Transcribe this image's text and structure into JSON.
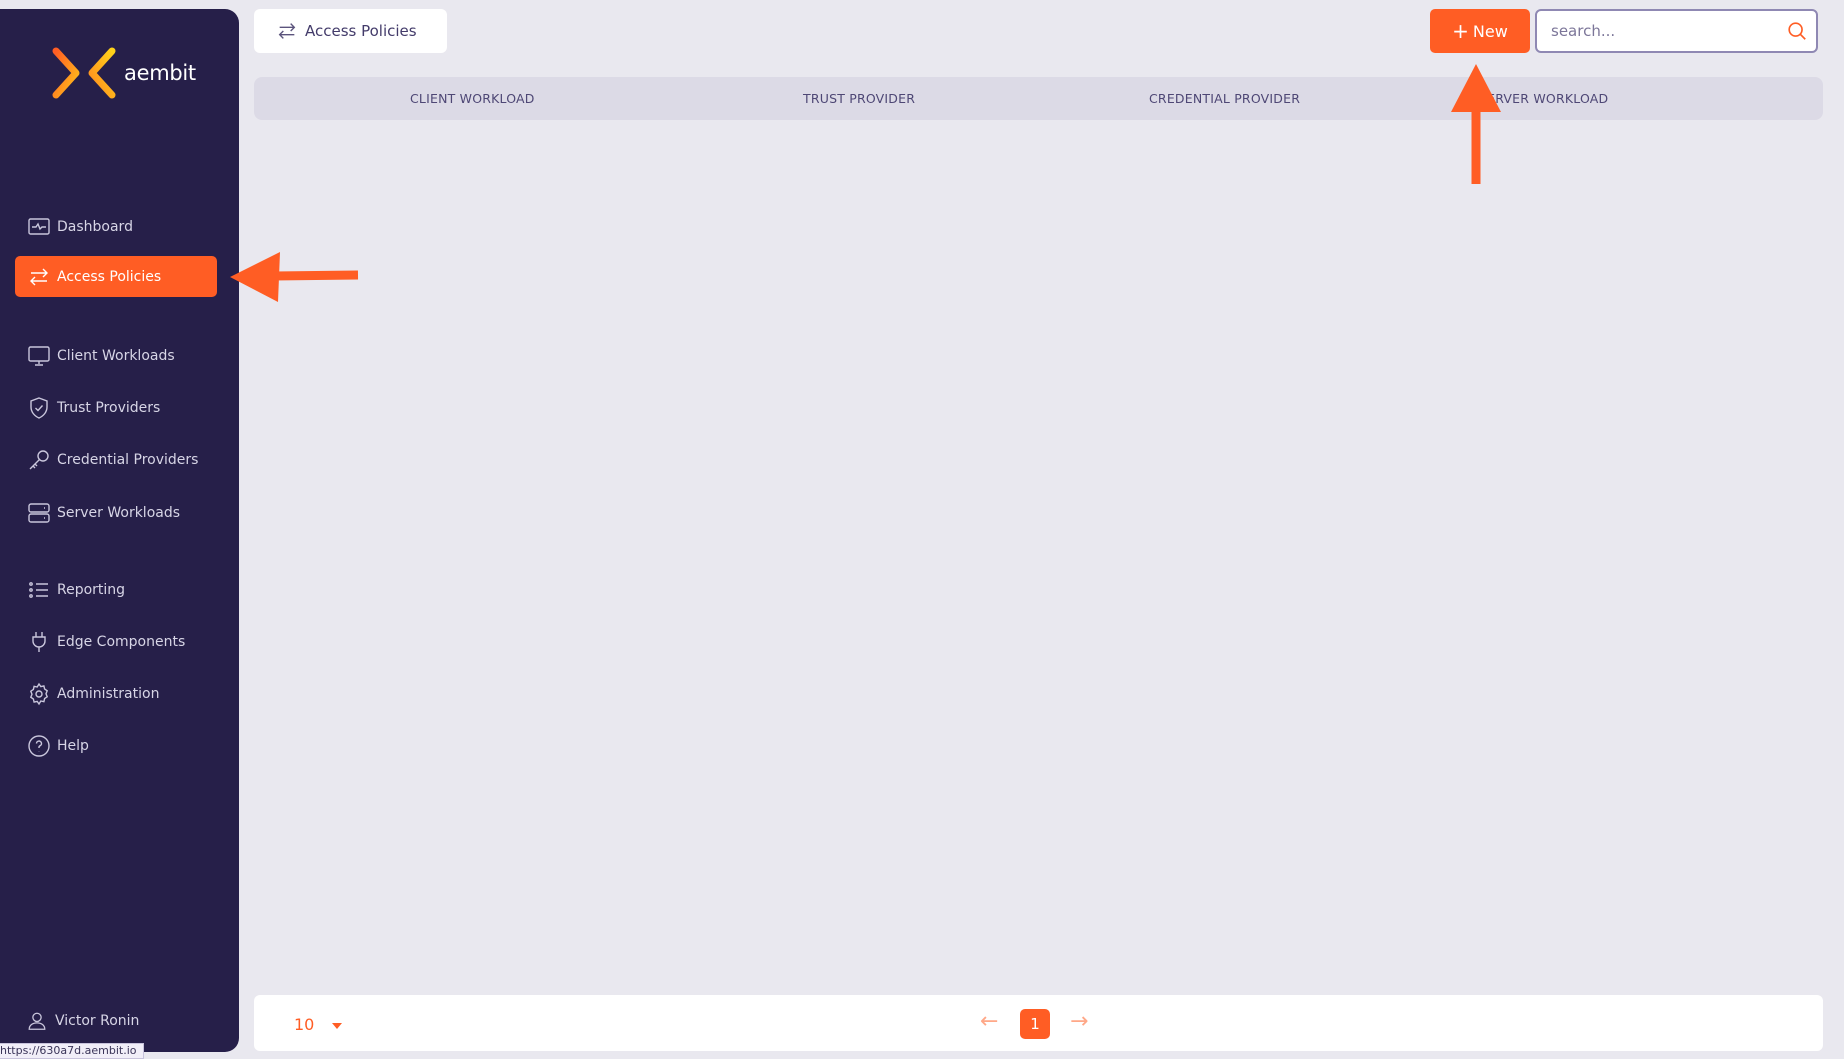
{
  "app": {
    "brand": "aembit",
    "accent_color": "#ff5d24",
    "sidebar_color": "#261f49"
  },
  "sidebar": {
    "items": [
      {
        "label": "Dashboard",
        "icon": "activity-monitor-icon"
      },
      {
        "label": "Access Policies",
        "icon": "arrows-exchange-icon",
        "active": true
      },
      {
        "label": "Client Workloads",
        "icon": "monitor-icon"
      },
      {
        "label": "Trust Providers",
        "icon": "shield-check-icon"
      },
      {
        "label": "Credential Providers",
        "icon": "key-icon"
      },
      {
        "label": "Server Workloads",
        "icon": "server-icon"
      },
      {
        "label": "Reporting",
        "icon": "list-icon"
      },
      {
        "label": "Edge Components",
        "icon": "plug-icon"
      },
      {
        "label": "Administration",
        "icon": "gear-icon"
      },
      {
        "label": "Help",
        "icon": "help-circle-icon"
      }
    ],
    "user": "Victor Ronin"
  },
  "status_url": "https://630a7d.aembit.io",
  "header": {
    "breadcrumb": "Access Policies",
    "new_label": "New",
    "search_placeholder": "search..."
  },
  "table": {
    "columns": [
      "CLIENT WORKLOAD",
      "TRUST PROVIDER",
      "CREDENTIAL PROVIDER",
      "SERVER WORKLOAD"
    ]
  },
  "pagination": {
    "page_size": "10",
    "current_page": "1",
    "prev": "←",
    "next": "→"
  }
}
